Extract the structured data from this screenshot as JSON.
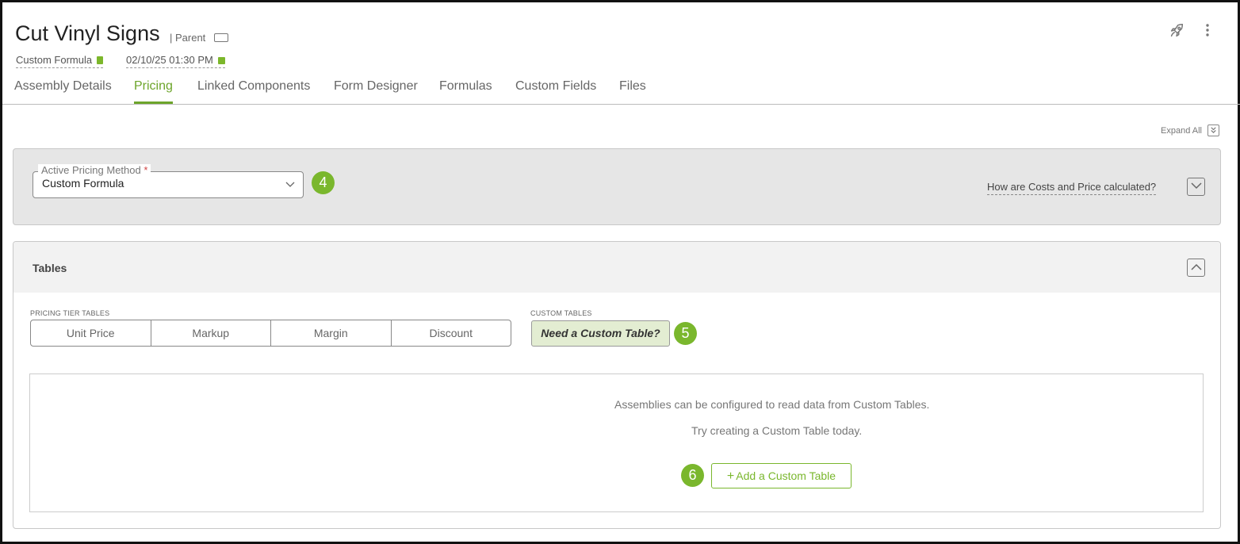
{
  "header": {
    "title": "Cut Vinyl Signs",
    "parent_label": "| Parent",
    "pricing_method_meta": "Custom Formula",
    "date_meta": "02/10/25 01:30 PM",
    "rocket_icon": "rocket-icon",
    "menu_icon": "more-vertical-icon"
  },
  "tabs": [
    {
      "label": "Assembly Details",
      "active": false
    },
    {
      "label": "Pricing",
      "active": true
    },
    {
      "label": "Linked Components",
      "active": false
    },
    {
      "label": "Form Designer",
      "active": false
    },
    {
      "label": "Formulas",
      "active": false
    },
    {
      "label": "Custom Fields",
      "active": false
    },
    {
      "label": "Files",
      "active": false
    }
  ],
  "expand_all_label": "Expand All",
  "pricing_method": {
    "label": "Active Pricing Method",
    "required_mark": "*",
    "value": "Custom Formula",
    "step_badge": "4",
    "how_link": "How are Costs and Price calculated?"
  },
  "tables": {
    "title": "Tables",
    "pricing_tier_label": "PRICING TIER TABLES",
    "tier_buttons": [
      "Unit Price",
      "Markup",
      "Margin",
      "Discount"
    ],
    "custom_tables_label": "CUSTOM TABLES",
    "custom_table_button": "Need a Custom Table?",
    "custom_step_badge": "5",
    "empty_line1": "Assemblies can be configured to read data from Custom Tables.",
    "empty_line2": "Try creating a Custom Table today.",
    "add_step_badge": "6",
    "add_button": "Add a Custom Table"
  },
  "colors": {
    "accent": "#7ab72d",
    "panel_bg": "#e6e6e6",
    "custom_btn_bg": "#e3edd2"
  }
}
